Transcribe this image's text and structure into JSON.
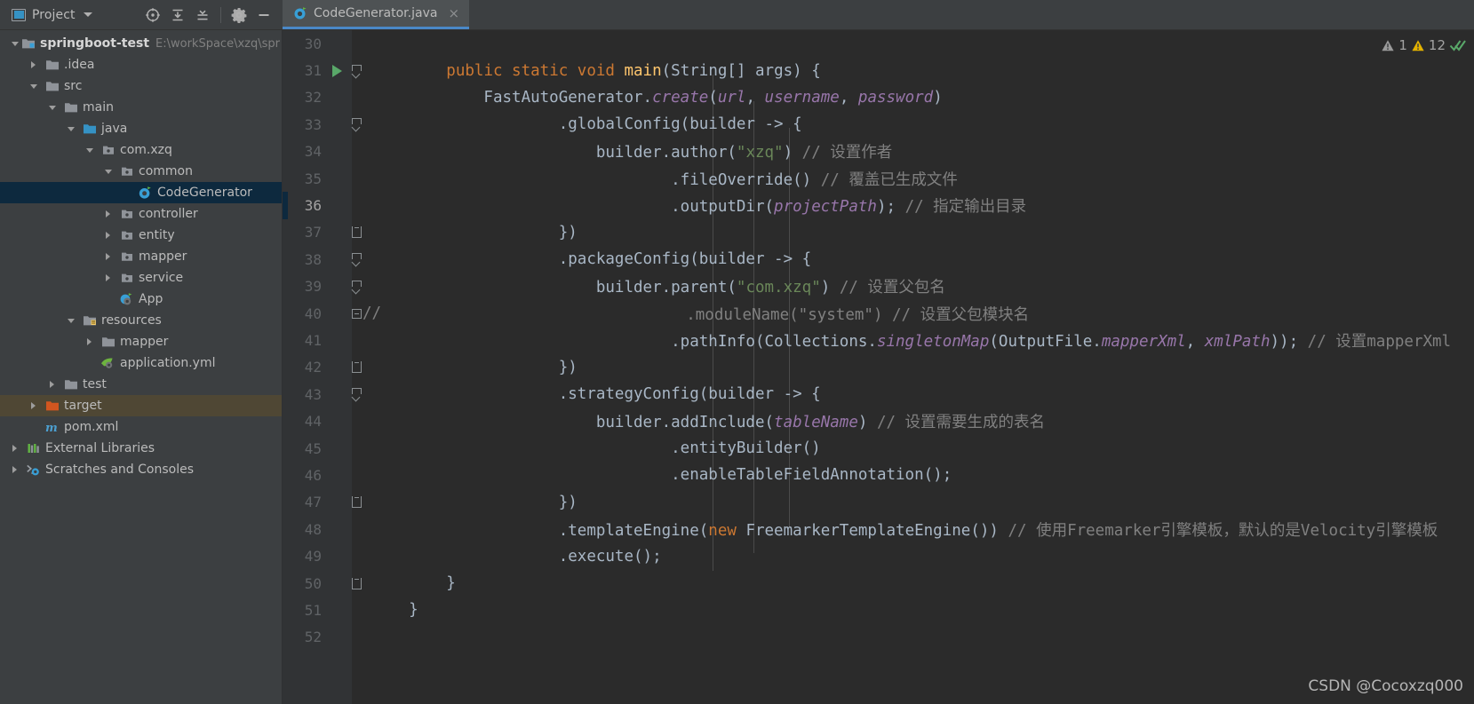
{
  "toolwindow": {
    "title": "Project",
    "dropdown_icon": "chevron-down-icon",
    "actions": [
      {
        "name": "locate-icon",
        "title": "Select Opened File"
      },
      {
        "name": "expand-all-icon",
        "title": "Expand All"
      },
      {
        "name": "collapse-all-icon",
        "title": "Collapse All"
      },
      {
        "name": "gear-icon",
        "title": "Options"
      },
      {
        "name": "minimize-icon",
        "title": "Hide"
      }
    ]
  },
  "tabs": [
    {
      "label": "CodeGenerator.java",
      "icon": "java-class-icon",
      "close_label": "×",
      "active": true
    }
  ],
  "tree": [
    {
      "indent": 0,
      "toggle": "down",
      "icon": "module-folder",
      "label": "springboot-test",
      "bold": true,
      "path": "E:\\workSpace\\xzq\\spr",
      "state": "normal"
    },
    {
      "indent": 1,
      "toggle": "right",
      "icon": "folder",
      "label": ".idea",
      "bold": false,
      "path": "",
      "state": "normal"
    },
    {
      "indent": 1,
      "toggle": "down",
      "icon": "folder",
      "label": "src",
      "bold": false,
      "path": "",
      "state": "normal"
    },
    {
      "indent": 2,
      "toggle": "down",
      "icon": "folder",
      "label": "main",
      "bold": false,
      "path": "",
      "state": "normal"
    },
    {
      "indent": 3,
      "toggle": "down",
      "icon": "source-folder",
      "label": "java",
      "bold": false,
      "path": "",
      "state": "normal"
    },
    {
      "indent": 4,
      "toggle": "down",
      "icon": "package",
      "label": "com.xzq",
      "bold": false,
      "path": "",
      "state": "normal"
    },
    {
      "indent": 5,
      "toggle": "down",
      "icon": "package",
      "label": "common",
      "bold": false,
      "path": "",
      "state": "normal"
    },
    {
      "indent": 6,
      "toggle": "none",
      "icon": "java-class-icon",
      "label": "CodeGenerator",
      "bold": false,
      "path": "",
      "state": "selected"
    },
    {
      "indent": 5,
      "toggle": "right",
      "icon": "package",
      "label": "controller",
      "bold": false,
      "path": "",
      "state": "normal"
    },
    {
      "indent": 5,
      "toggle": "right",
      "icon": "package",
      "label": "entity",
      "bold": false,
      "path": "",
      "state": "normal"
    },
    {
      "indent": 5,
      "toggle": "right",
      "icon": "package",
      "label": "mapper",
      "bold": false,
      "path": "",
      "state": "normal"
    },
    {
      "indent": 5,
      "toggle": "right",
      "icon": "package",
      "label": "service",
      "bold": false,
      "path": "",
      "state": "normal"
    },
    {
      "indent": 5,
      "toggle": "none",
      "icon": "spring-class-icon",
      "label": "App",
      "bold": false,
      "path": "",
      "state": "normal"
    },
    {
      "indent": 3,
      "toggle": "down",
      "icon": "resource-folder",
      "label": "resources",
      "bold": false,
      "path": "",
      "state": "normal"
    },
    {
      "indent": 4,
      "toggle": "right",
      "icon": "folder",
      "label": "mapper",
      "bold": false,
      "path": "",
      "state": "normal"
    },
    {
      "indent": 4,
      "toggle": "none",
      "icon": "yaml-spring-icon",
      "label": "application.yml",
      "bold": false,
      "path": "",
      "state": "normal"
    },
    {
      "indent": 2,
      "toggle": "right",
      "icon": "folder",
      "label": "test",
      "bold": false,
      "path": "",
      "state": "normal"
    },
    {
      "indent": 1,
      "toggle": "right",
      "icon": "target-folder",
      "label": "target",
      "bold": false,
      "path": "",
      "state": "highlight"
    },
    {
      "indent": 1,
      "toggle": "none",
      "icon": "maven-icon",
      "label": "pom.xml",
      "bold": false,
      "path": "",
      "state": "normal"
    },
    {
      "indent": 0,
      "toggle": "right",
      "icon": "libraries-icon",
      "label": "External Libraries",
      "bold": false,
      "path": "",
      "state": "normal"
    },
    {
      "indent": 0,
      "toggle": "right",
      "icon": "scratches-icon",
      "label": "Scratches and Consoles",
      "bold": false,
      "path": "",
      "state": "normal"
    }
  ],
  "inspections": {
    "weak_warning_icon": "grey-warning-triangle-icon",
    "weak_warning_count": "1",
    "warning_icon": "yellow-warning-triangle-icon",
    "warning_count": "12",
    "status_icon": "green-double-check-icon"
  },
  "watermark": "CSDN @Cocoxzq000",
  "editor": {
    "first_visible_line": 30,
    "lines": [
      {
        "num": "30",
        "gutter": "",
        "current": false,
        "tokens": []
      },
      {
        "num": "31",
        "gutter": "run-arrow",
        "fold": "fold-top",
        "current": false,
        "tokens": [
          {
            "t": "        ",
            "c": "txt"
          },
          {
            "t": "public static void ",
            "c": "kw"
          },
          {
            "t": "main",
            "c": "mth"
          },
          {
            "t": "(String[] args) {",
            "c": "txt"
          }
        ]
      },
      {
        "num": "32",
        "gutter": "",
        "current": false,
        "tokens": [
          {
            "t": "            FastAutoGenerator.",
            "c": "txt"
          },
          {
            "t": "create",
            "c": "stat"
          },
          {
            "t": "(",
            "c": "txt"
          },
          {
            "t": "url",
            "c": "fld"
          },
          {
            "t": ", ",
            "c": "txt"
          },
          {
            "t": "username",
            "c": "fld"
          },
          {
            "t": ", ",
            "c": "txt"
          },
          {
            "t": "password",
            "c": "fld"
          },
          {
            "t": ")",
            "c": "txt"
          }
        ]
      },
      {
        "num": "33",
        "gutter": "",
        "fold": "fold-top",
        "current": false,
        "tokens": [
          {
            "t": "                    .globalConfig(builder -> {",
            "c": "txt"
          }
        ]
      },
      {
        "num": "34",
        "gutter": "",
        "current": false,
        "tokens": [
          {
            "t": "                        builder.author(",
            "c": "txt"
          },
          {
            "t": "\"xzq\"",
            "c": "str"
          },
          {
            "t": ") ",
            "c": "txt"
          },
          {
            "t": "// 设置作者",
            "c": "cmt"
          }
        ]
      },
      {
        "num": "35",
        "gutter": "",
        "current": false,
        "tokens": [
          {
            "t": "                                .fileOverride() ",
            "c": "txt"
          },
          {
            "t": "// 覆盖已生成文件",
            "c": "cmt"
          }
        ]
      },
      {
        "num": "36",
        "gutter": "",
        "current": true,
        "tokens": [
          {
            "t": "                                .outputDir(",
            "c": "txt"
          },
          {
            "t": "projectPath",
            "c": "fld"
          },
          {
            "t": "); ",
            "c": "txt"
          },
          {
            "t": "// 指定输出目录",
            "c": "cmt"
          }
        ]
      },
      {
        "num": "37",
        "gutter": "",
        "fold": "fold-bot",
        "current": false,
        "tokens": [
          {
            "t": "                    })",
            "c": "txt"
          }
        ]
      },
      {
        "num": "38",
        "gutter": "",
        "fold": "fold-top",
        "current": false,
        "tokens": [
          {
            "t": "                    .packageConfig(builder -> {",
            "c": "txt"
          }
        ]
      },
      {
        "num": "39",
        "gutter": "",
        "fold": "fold-top",
        "current": false,
        "tokens": [
          {
            "t": "                        builder.parent(",
            "c": "txt"
          },
          {
            "t": "\"com.xzq\"",
            "c": "str"
          },
          {
            "t": ") ",
            "c": "txt"
          },
          {
            "t": "// 设置父包名",
            "c": "cmt"
          }
        ]
      },
      {
        "num": "40",
        "gutter": "",
        "fold": "fold-box",
        "foldtext": "//",
        "current": false,
        "tokens": [
          {
            "t": "                                .moduleName(\"system\") // 设置父包模块名",
            "c": "cmt"
          }
        ]
      },
      {
        "num": "41",
        "gutter": "",
        "current": false,
        "tokens": [
          {
            "t": "                                .pathInfo(Collections.",
            "c": "txt"
          },
          {
            "t": "singletonMap",
            "c": "stat"
          },
          {
            "t": "(OutputFile.",
            "c": "txt"
          },
          {
            "t": "mapperXml",
            "c": "fld"
          },
          {
            "t": ", ",
            "c": "txt"
          },
          {
            "t": "xmlPath",
            "c": "fld"
          },
          {
            "t": ")); ",
            "c": "txt"
          },
          {
            "t": "// 设置mapperXml",
            "c": "cmt"
          }
        ]
      },
      {
        "num": "42",
        "gutter": "",
        "fold": "fold-bot",
        "current": false,
        "tokens": [
          {
            "t": "                    })",
            "c": "txt"
          }
        ]
      },
      {
        "num": "43",
        "gutter": "",
        "fold": "fold-top",
        "current": false,
        "tokens": [
          {
            "t": "                    .strategyConfig(builder -> {",
            "c": "txt"
          }
        ]
      },
      {
        "num": "44",
        "gutter": "",
        "current": false,
        "tokens": [
          {
            "t": "                        builder.addInclude(",
            "c": "txt"
          },
          {
            "t": "tableName",
            "c": "fld"
          },
          {
            "t": ") ",
            "c": "txt"
          },
          {
            "t": "// 设置需要生成的表名",
            "c": "cmt"
          }
        ]
      },
      {
        "num": "45",
        "gutter": "",
        "current": false,
        "tokens": [
          {
            "t": "                                .entityBuilder()",
            "c": "txt"
          }
        ]
      },
      {
        "num": "46",
        "gutter": "",
        "current": false,
        "tokens": [
          {
            "t": "                                .enableTableFieldAnnotation();",
            "c": "txt"
          }
        ]
      },
      {
        "num": "47",
        "gutter": "",
        "fold": "fold-bot",
        "current": false,
        "tokens": [
          {
            "t": "                    })",
            "c": "txt"
          }
        ]
      },
      {
        "num": "48",
        "gutter": "",
        "current": false,
        "tokens": [
          {
            "t": "                    .templateEngine(",
            "c": "txt"
          },
          {
            "t": "new ",
            "c": "kw"
          },
          {
            "t": "FreemarkerTemplateEngine()) ",
            "c": "txt"
          },
          {
            "t": "// 使用Freemarker引擎模板，默认的是Velocity引擎模板",
            "c": "cmt"
          }
        ]
      },
      {
        "num": "49",
        "gutter": "",
        "current": false,
        "tokens": [
          {
            "t": "                    .execute();",
            "c": "txt"
          }
        ]
      },
      {
        "num": "50",
        "gutter": "",
        "fold": "fold-bot",
        "current": false,
        "tokens": [
          {
            "t": "        }",
            "c": "txt"
          }
        ]
      },
      {
        "num": "51",
        "gutter": "",
        "current": false,
        "tokens": [
          {
            "t": "    }",
            "c": "txt"
          }
        ]
      },
      {
        "num": "52",
        "gutter": "",
        "current": false,
        "tokens": []
      }
    ]
  }
}
